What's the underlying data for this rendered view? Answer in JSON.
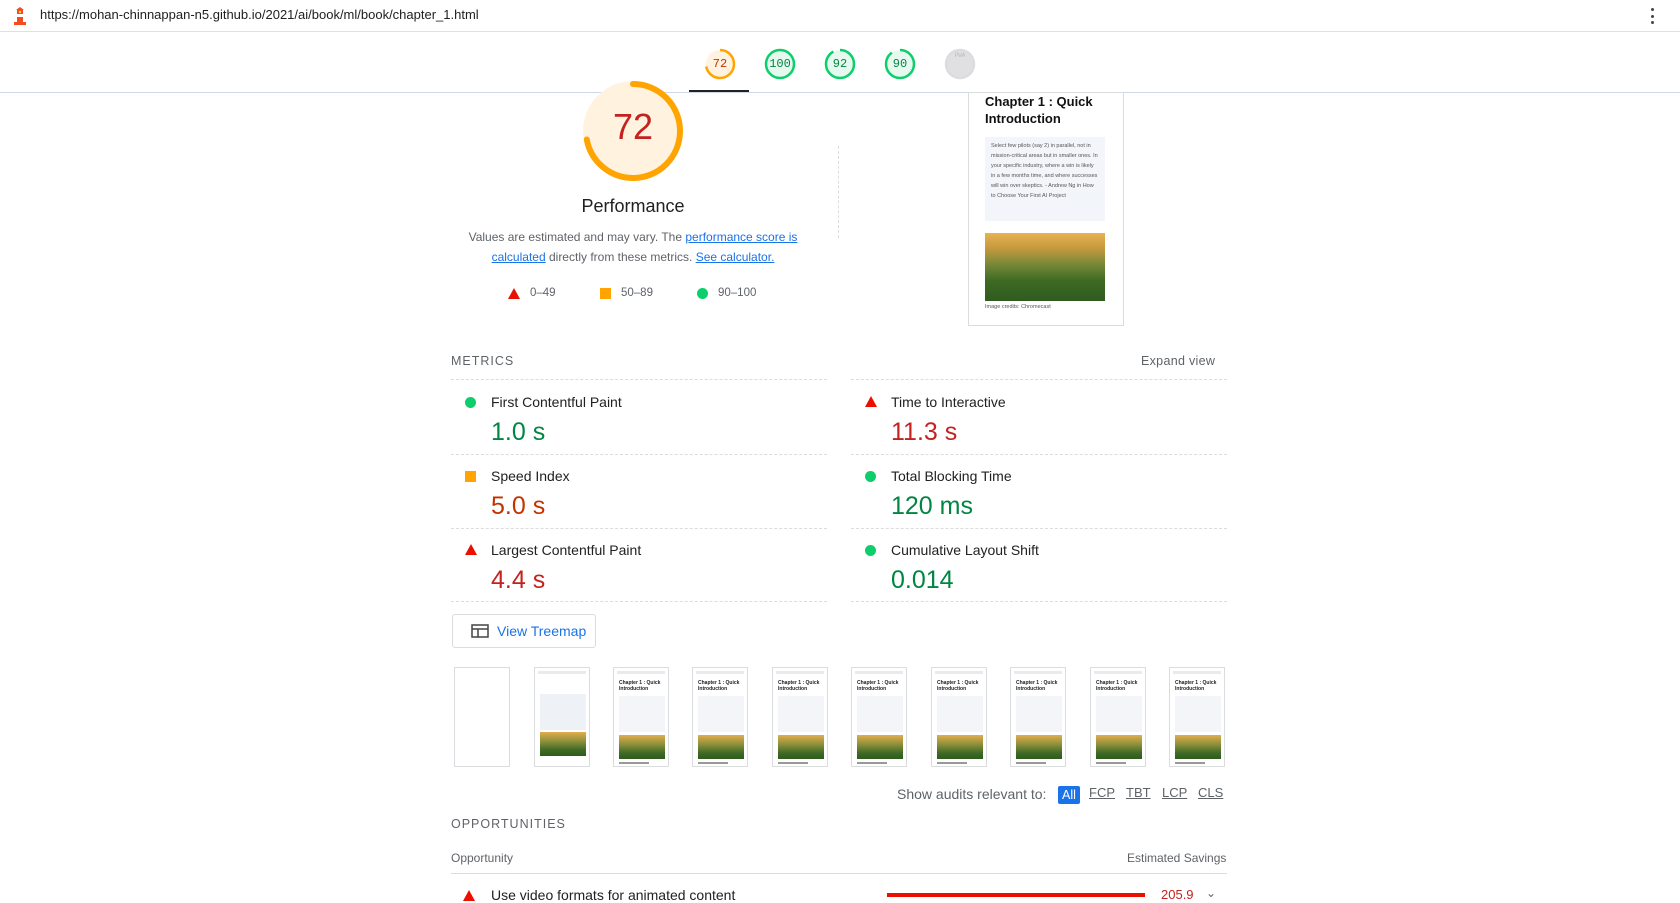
{
  "browser": {
    "url": "https://mohan-chinnappan-n5.github.io/2021/ai/book/ml/book/chapter_1.html",
    "logo_icon": "lighthouse-icon",
    "menu_icon": "kebab-menu-icon"
  },
  "header_scores": [
    {
      "label": "72",
      "score": 72,
      "color": "#ffa400",
      "text_color": "#c33300"
    },
    {
      "label": "100",
      "score": 100,
      "color": "#0cce6b",
      "text_color": "#018642"
    },
    {
      "label": "92",
      "score": 92,
      "color": "#0cce6b",
      "text_color": "#018642"
    },
    {
      "label": "90",
      "score": 90,
      "color": "#0cce6b",
      "text_color": "#018642"
    },
    {
      "label": "PWA",
      "score": null,
      "color": "#dadce0",
      "text_color": "#bdbdbd"
    }
  ],
  "performance": {
    "score": "72",
    "score_value": 72,
    "title": "Performance",
    "desc_prefix": "Values are estimated and may vary. The ",
    "desc_link": "performance score is calculated",
    "desc_middle": " directly from these metrics. ",
    "desc_link2": "See calculator.",
    "legend": [
      {
        "range": "0–49",
        "shape": "triangle",
        "color": "#eb0f00"
      },
      {
        "range": "50–89",
        "shape": "square",
        "color": "#ffa400"
      },
      {
        "range": "90–100",
        "shape": "circle",
        "color": "#0cce6b"
      }
    ]
  },
  "preview": {
    "title": "Chapter 1 : Quick Introduction",
    "quote": "Select few pilots (say 2) in parallel, not in mission-critical areas but in smaller ones. In your specific industry, where a win is likely in a few months time, and where successes will win over skeptics. - Andrew Ng in How to Choose Your First AI Project",
    "caption": "Image credits: Chromecast"
  },
  "metrics": {
    "heading": "METRICS",
    "expand_label": "Expand view",
    "items": [
      {
        "name": "First Contentful Paint",
        "value": "1.0 s",
        "status": "good"
      },
      {
        "name": "Time to Interactive",
        "value": "11.3 s",
        "status": "bad"
      },
      {
        "name": "Speed Index",
        "value": "5.0 s",
        "status": "average"
      },
      {
        "name": "Total Blocking Time",
        "value": "120 ms",
        "status": "good"
      },
      {
        "name": "Largest Contentful Paint",
        "value": "4.4 s",
        "status": "bad"
      },
      {
        "name": "Cumulative Layout Shift",
        "value": "0.014",
        "status": "good"
      }
    ]
  },
  "treemap": {
    "label": "View Treemap",
    "icon": "treemap-icon"
  },
  "filmstrip": {
    "frame_title": "Chapter 1 : Quick Introduction",
    "frames": [
      "blank",
      "partial",
      "full",
      "full",
      "full",
      "full",
      "full",
      "full",
      "full",
      "full"
    ]
  },
  "audit_filter": {
    "label": "Show audits relevant to:",
    "options": [
      "All",
      "FCP",
      "TBT",
      "LCP",
      "CLS"
    ],
    "selected": "All"
  },
  "opportunities": {
    "heading": "OPPORTUNITIES",
    "col_opportunity": "Opportunity",
    "col_savings": "Estimated Savings",
    "items": [
      {
        "title": "Use video formats for animated content",
        "savings": "205.9",
        "status": "bad",
        "bar_fraction": 1.0
      }
    ]
  }
}
